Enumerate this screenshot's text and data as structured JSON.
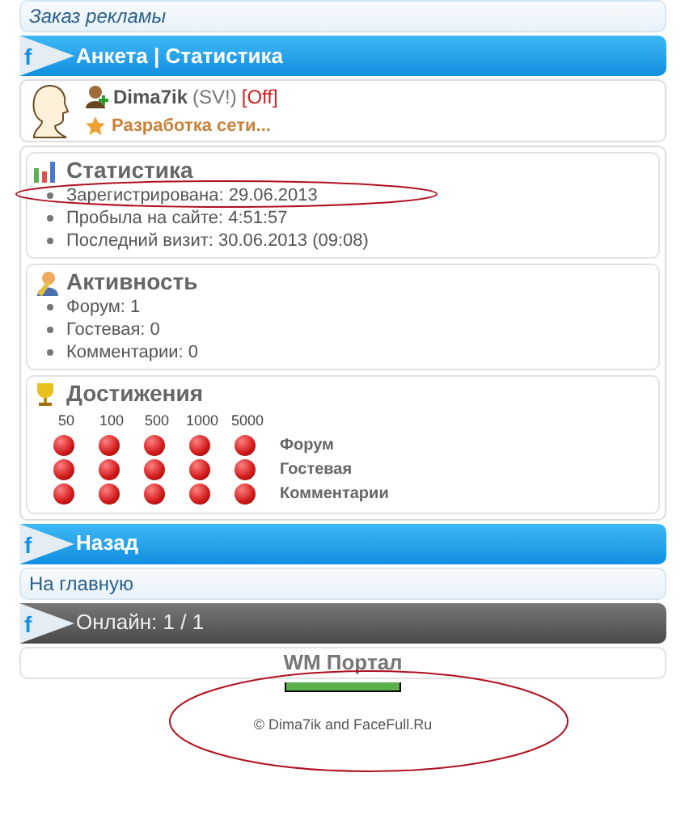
{
  "ad_link": "Заказ рекламы",
  "headers": [
    {
      "kind": "blue",
      "icon": "f",
      "title": "Анкета | Статистика"
    },
    {
      "kind": "blue",
      "icon": "f",
      "title": "Назад"
    },
    {
      "kind": "dark",
      "icon": "f",
      "title": "Онлайн: 1 / 1"
    }
  ],
  "profile": {
    "name": "Dima7ik",
    "tag": "(SV!)",
    "status": "[Off]",
    "role": "Разработка сети..."
  },
  "sections": [
    {
      "kind": "stats",
      "title": "Статистика",
      "items": [
        "Зарегистрирована: 29.06.2013",
        "Пробыла на сайте: 4:51:57",
        "Последний визит: 30.06.2013 (09:08)"
      ]
    },
    {
      "kind": "activity",
      "title": "Активность",
      "items": [
        "Форум: 1",
        "Гостевая: 0",
        "Комментарии: 0"
      ]
    }
  ],
  "achievements": {
    "title": "Достижения",
    "levels": [
      "50",
      "100",
      "500",
      "1000",
      "5000"
    ],
    "rows": [
      "Форум",
      "Гостевая",
      "Комментарии"
    ]
  },
  "back_link": "На главную",
  "footer": {
    "title": "WM Портал",
    "copyright": "© Dima7ik and FaceFull.Ru"
  }
}
